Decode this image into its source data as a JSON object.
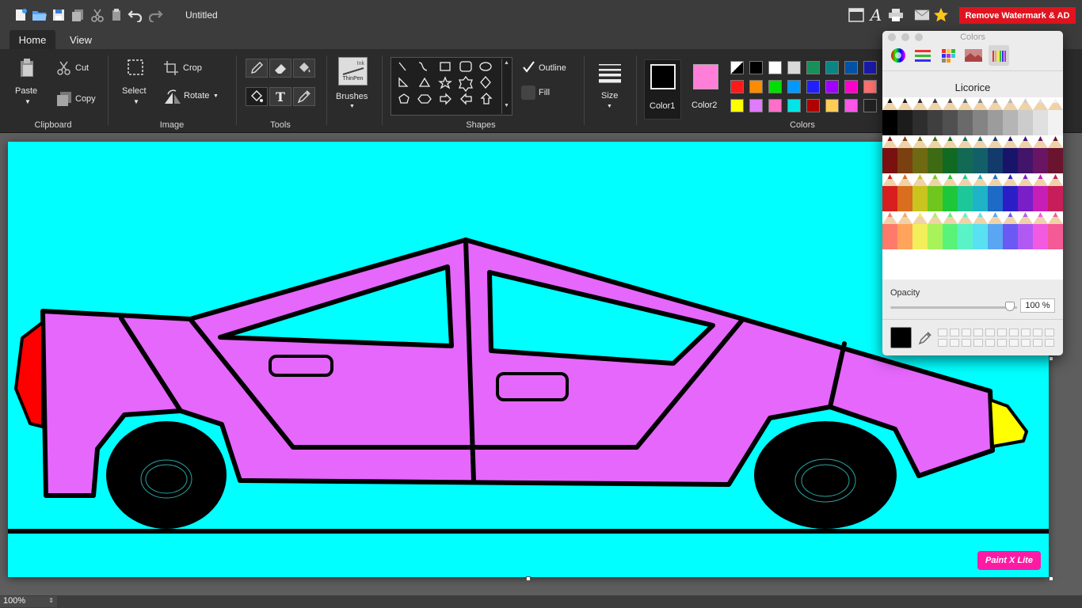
{
  "titlebar": {
    "doc_title": "Untitled",
    "remove_watermark_label": "Remove Watermark & AD",
    "icons": [
      "new-file-icon",
      "open-folder-icon",
      "save-icon",
      "copy-pages-icon",
      "scissors-icon",
      "paste-icon",
      "undo-icon",
      "redo-icon",
      "window-icon",
      "font-icon",
      "printer-icon",
      "mail-icon",
      "star-icon"
    ]
  },
  "tabs": {
    "home": "Home",
    "view": "View"
  },
  "ribbon": {
    "clipboard": {
      "paste": "Paste",
      "cut": "Cut",
      "copy": "Copy",
      "group": "Clipboard"
    },
    "image": {
      "select": "Select",
      "crop": "Crop",
      "rotate": "Rotate",
      "group": "Image"
    },
    "tools": {
      "group": "Tools"
    },
    "brushes": {
      "label": "Brushes",
      "brush_name_top": "Ink",
      "brush_name": "ThinPen"
    },
    "shapes": {
      "group": "Shapes",
      "outline": "Outline",
      "fill": "Fill"
    },
    "size": {
      "label": "Size"
    },
    "colors": {
      "color1": "Color1",
      "color2": "Color2",
      "group": "Colors",
      "color1_value": "#000000",
      "color2_value": "#ff7fd8",
      "palette": [
        [
          "split",
          "#000000",
          "#ffffff",
          "#d9d9d9",
          "#17905a",
          "#0a8585",
          "#0052a6",
          "#1a1aa8"
        ],
        [
          "#ff1a1a",
          "#ff8c00",
          "#00e000",
          "#0099ff",
          "#2020ff",
          "#a000ff",
          "#ff00cc",
          "#ff6f6f"
        ],
        [
          "#ffff00",
          "#e07aff",
          "#ff6fc8",
          "#00e5e5",
          "#b00000",
          "#ffcc55",
          "#ff55e8",
          "#222222"
        ]
      ]
    }
  },
  "canvas": {
    "background": "#00ffff",
    "watermark": "Paint X Lite"
  },
  "status": {
    "zoom": "100%"
  },
  "colors_panel": {
    "title": "Colors",
    "selected_name": "Licorice",
    "opacity_label": "Opacity",
    "opacity_value": "100 %",
    "opacity_fraction": 1.0,
    "current_color": "#000000",
    "toolbar_icons": [
      "color-wheel-icon",
      "color-sliders-icon",
      "color-palettes-icon",
      "image-palettes-icon",
      "pencils-icon"
    ]
  }
}
